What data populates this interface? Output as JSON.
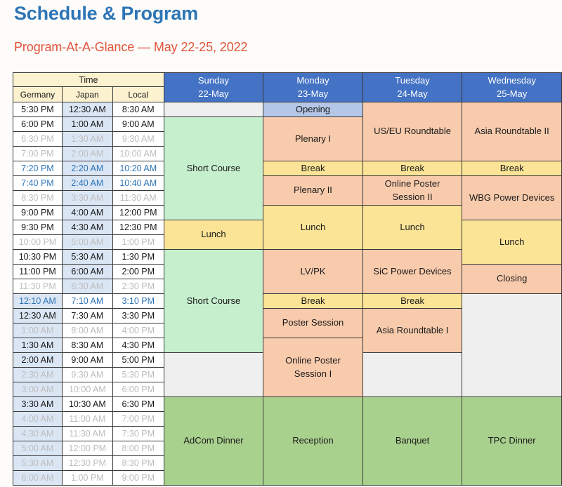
{
  "header": {
    "title": "Schedule & Program",
    "subtitle": "Program-At-A-Glance — May 22-25, 2022"
  },
  "colors": {
    "title": "#2E75B6",
    "subtitle": "#E1533A",
    "day_header_bg": "#4472C4",
    "time_header_bg": "#FDF2D0",
    "session_green": "#C6EFCE",
    "session_salmon": "#F8CBAD",
    "break_yellow": "#FCE497",
    "dinner_green": "#A9D18E",
    "opening_blue": "#B4C7E7",
    "empty_grey": "#EFEFEF",
    "highlight_col": "#DBE6F5"
  },
  "table": {
    "time_group_label": "Time",
    "time_columns": [
      "Germany",
      "Japan",
      "Local"
    ],
    "day_columns": [
      {
        "name": "Sunday",
        "date": "22-May"
      },
      {
        "name": "Monday",
        "date": "23-May"
      },
      {
        "name": "Tuesday",
        "date": "24-May"
      },
      {
        "name": "Wednesday",
        "date": "25-May"
      }
    ],
    "rows": [
      {
        "germany": "5:30 PM",
        "japan": "12:30 AM",
        "local": "8:30 AM",
        "style": "normal",
        "highlight": "japan"
      },
      {
        "germany": "6:00 PM",
        "japan": "1:00 AM",
        "local": "9:00 AM",
        "style": "normal",
        "highlight": "japan"
      },
      {
        "germany": "6:30 PM",
        "japan": "1:30 AM",
        "local": "9:30 AM",
        "style": "dim",
        "highlight": "japan"
      },
      {
        "germany": "7:00 PM",
        "japan": "2:00 AM",
        "local": "10:00 AM",
        "style": "dim",
        "highlight": "japan"
      },
      {
        "germany": "7:20 PM",
        "japan": "2:20 AM",
        "local": "10:20 AM",
        "style": "blue",
        "highlight": "japan"
      },
      {
        "germany": "7:40 PM",
        "japan": "2:40 AM",
        "local": "10:40 AM",
        "style": "blue",
        "highlight": "japan"
      },
      {
        "germany": "8:30 PM",
        "japan": "3:30 AM",
        "local": "11:30 AM",
        "style": "dim",
        "highlight": "japan"
      },
      {
        "germany": "9:00 PM",
        "japan": "4:00 AM",
        "local": "12:00 PM",
        "style": "normal",
        "highlight": "japan"
      },
      {
        "germany": "9:30 PM",
        "japan": "4:30 AM",
        "local": "12:30 PM",
        "style": "normal",
        "highlight": "japan"
      },
      {
        "germany": "10:00 PM",
        "japan": "5:00 AM",
        "local": "1:00 PM",
        "style": "dim",
        "highlight": "japan"
      },
      {
        "germany": "10:30 PM",
        "japan": "5:30 AM",
        "local": "1:30 PM",
        "style": "normal",
        "highlight": "japan"
      },
      {
        "germany": "11:00 PM",
        "japan": "6:00 AM",
        "local": "2:00 PM",
        "style": "normal",
        "highlight": "japan"
      },
      {
        "germany": "11:30 PM",
        "japan": "6:30 AM",
        "local": "2:30 PM",
        "style": "dim",
        "highlight": "japan"
      },
      {
        "germany": "12:10 AM",
        "japan": "7:10 AM",
        "local": "3:10 PM",
        "style": "blue",
        "highlight": "germany"
      },
      {
        "germany": "12:30 AM",
        "japan": "7:30 AM",
        "local": "3:30 PM",
        "style": "normal",
        "highlight": "germany"
      },
      {
        "germany": "1:00 AM",
        "japan": "8:00 AM",
        "local": "4:00 PM",
        "style": "dim",
        "highlight": "germany"
      },
      {
        "germany": "1:30 AM",
        "japan": "8:30 AM",
        "local": "4:30 PM",
        "style": "normal",
        "highlight": "germany"
      },
      {
        "germany": "2:00 AM",
        "japan": "9:00 AM",
        "local": "5:00 PM",
        "style": "normal",
        "highlight": "germany"
      },
      {
        "germany": "2:30 AM",
        "japan": "9:30 AM",
        "local": "5:30 PM",
        "style": "dim",
        "highlight": "germany"
      },
      {
        "germany": "3:00 AM",
        "japan": "10:00 AM",
        "local": "6:00 PM",
        "style": "dim",
        "highlight": "germany"
      },
      {
        "germany": "3:30 AM",
        "japan": "10:30 AM",
        "local": "6:30 PM",
        "style": "normal",
        "highlight": "germany"
      },
      {
        "germany": "4:00 AM",
        "japan": "11:00 AM",
        "local": "7:00 PM",
        "style": "dim",
        "highlight": "germany"
      },
      {
        "germany": "4:30 AM",
        "japan": "11:30 AM",
        "local": "7:30 PM",
        "style": "dim",
        "highlight": "germany"
      },
      {
        "germany": "5:00 AM",
        "japan": "12:00 PM",
        "local": "8:00 PM",
        "style": "dim",
        "highlight": "germany"
      },
      {
        "germany": "5:30 AM",
        "japan": "12:30 PM",
        "local": "8:30 PM",
        "style": "dim",
        "highlight": "germany"
      },
      {
        "germany": "6:00 AM",
        "japan": "1:00 PM",
        "local": "9:00 PM",
        "style": "dim",
        "highlight": "germany"
      }
    ],
    "events": {
      "sunday": [
        {
          "label": "",
          "start": 0,
          "span": 1,
          "color": "empty"
        },
        {
          "label": "Short Course",
          "start": 1,
          "span": 7,
          "color": "green"
        },
        {
          "label": "Lunch",
          "start": 8,
          "span": 2,
          "color": "yellow"
        },
        {
          "label": "Short Course",
          "start": 10,
          "span": 7,
          "color": "green"
        },
        {
          "label": "",
          "start": 17,
          "span": 3,
          "color": "empty"
        },
        {
          "label": "AdCom Dinner",
          "start": 20,
          "span": 6,
          "color": "dgreen"
        }
      ],
      "monday": [
        {
          "label": "Opening",
          "start": 0,
          "span": 1,
          "color": "blue"
        },
        {
          "label": "Plenary I",
          "start": 1,
          "span": 3,
          "color": "salmon"
        },
        {
          "label": "Break",
          "start": 4,
          "span": 1,
          "color": "yellow"
        },
        {
          "label": "Plenary II",
          "start": 5,
          "span": 2,
          "color": "salmon"
        },
        {
          "label": "Lunch",
          "start": 7,
          "span": 3,
          "color": "yellow"
        },
        {
          "label": "LV/PK",
          "start": 10,
          "span": 3,
          "color": "salmon"
        },
        {
          "label": "Break",
          "start": 13,
          "span": 1,
          "color": "yellow"
        },
        {
          "label": "Poster Session",
          "start": 14,
          "span": 2,
          "color": "salmon"
        },
        {
          "label": "Online Poster\nSession I",
          "start": 16,
          "span": 4,
          "color": "salmon"
        },
        {
          "label": "Reception",
          "start": 20,
          "span": 6,
          "color": "dgreen"
        }
      ],
      "tuesday": [
        {
          "label": "US/EU Roundtable",
          "start": 0,
          "span": 4,
          "color": "salmon"
        },
        {
          "label": "Break",
          "start": 4,
          "span": 1,
          "color": "yellow"
        },
        {
          "label": "Online Poster\nSession II",
          "start": 5,
          "span": 2,
          "color": "salmon"
        },
        {
          "label": "Lunch",
          "start": 7,
          "span": 3,
          "color": "yellow"
        },
        {
          "label": "SiC Power Devices",
          "start": 10,
          "span": 3,
          "color": "salmon"
        },
        {
          "label": "Break",
          "start": 13,
          "span": 1,
          "color": "yellow"
        },
        {
          "label": "Asia Roundtable I",
          "start": 14,
          "span": 3,
          "color": "salmon"
        },
        {
          "label": "",
          "start": 17,
          "span": 3,
          "color": "empty"
        },
        {
          "label": "Banquet",
          "start": 20,
          "span": 6,
          "color": "dgreen"
        }
      ],
      "wednesday": [
        {
          "label": "Asia Roundtable II",
          "start": 0,
          "span": 4,
          "color": "salmon"
        },
        {
          "label": "Break",
          "start": 4,
          "span": 1,
          "color": "yellow"
        },
        {
          "label": "WBG Power Devices",
          "start": 5,
          "span": 3,
          "color": "salmon"
        },
        {
          "label": "Lunch",
          "start": 8,
          "span": 3,
          "color": "yellow"
        },
        {
          "label": "Closing",
          "start": 11,
          "span": 2,
          "color": "salmon"
        },
        {
          "label": "",
          "start": 13,
          "span": 7,
          "color": "empty"
        },
        {
          "label": "TPC Dinner",
          "start": 20,
          "span": 6,
          "color": "dgreen"
        }
      ]
    }
  }
}
